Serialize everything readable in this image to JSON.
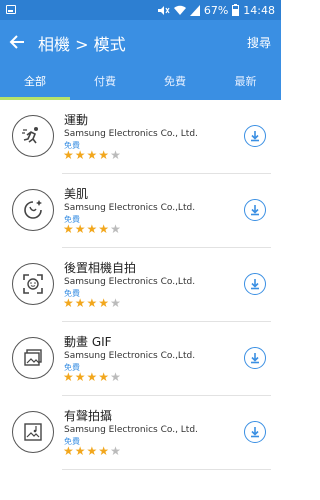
{
  "status_bar": {
    "battery": "67%",
    "time": "14:48"
  },
  "app_bar": {
    "title": "相機 > 模式",
    "search_label": "搜尋"
  },
  "tabs": [
    {
      "label": "全部",
      "active": true
    },
    {
      "label": "付費",
      "active": false
    },
    {
      "label": "免費",
      "active": false
    },
    {
      "label": "最新",
      "active": false
    }
  ],
  "items": [
    {
      "name": "運動",
      "developer": "Samsung Electronics Co., Ltd.",
      "price": "免費",
      "rating": 4,
      "icon": "sports-icon"
    },
    {
      "name": "美肌",
      "developer": "Samsung Electronics Co.,Ltd.",
      "price": "免費",
      "rating": 4,
      "icon": "beauty-icon"
    },
    {
      "name": "後置相機自拍",
      "developer": "Samsung Electronics Co.,Ltd.",
      "price": "免費",
      "rating": 4,
      "icon": "rear-selfie-icon"
    },
    {
      "name": "動畫 GIF",
      "developer": "Samsung Electronics Co.,Ltd.",
      "price": "免費",
      "rating": 4,
      "icon": "gif-icon"
    },
    {
      "name": "有聲拍攝",
      "developer": "Samsung Electronics Co., Ltd.",
      "price": "免費",
      "rating": 4,
      "icon": "sound-shot-icon"
    }
  ],
  "colors": {
    "primary": "#3a8fe3",
    "status_bar": "#2d7fd2",
    "tab_indicator": "#b6e26a",
    "star": "#f2a71d"
  }
}
